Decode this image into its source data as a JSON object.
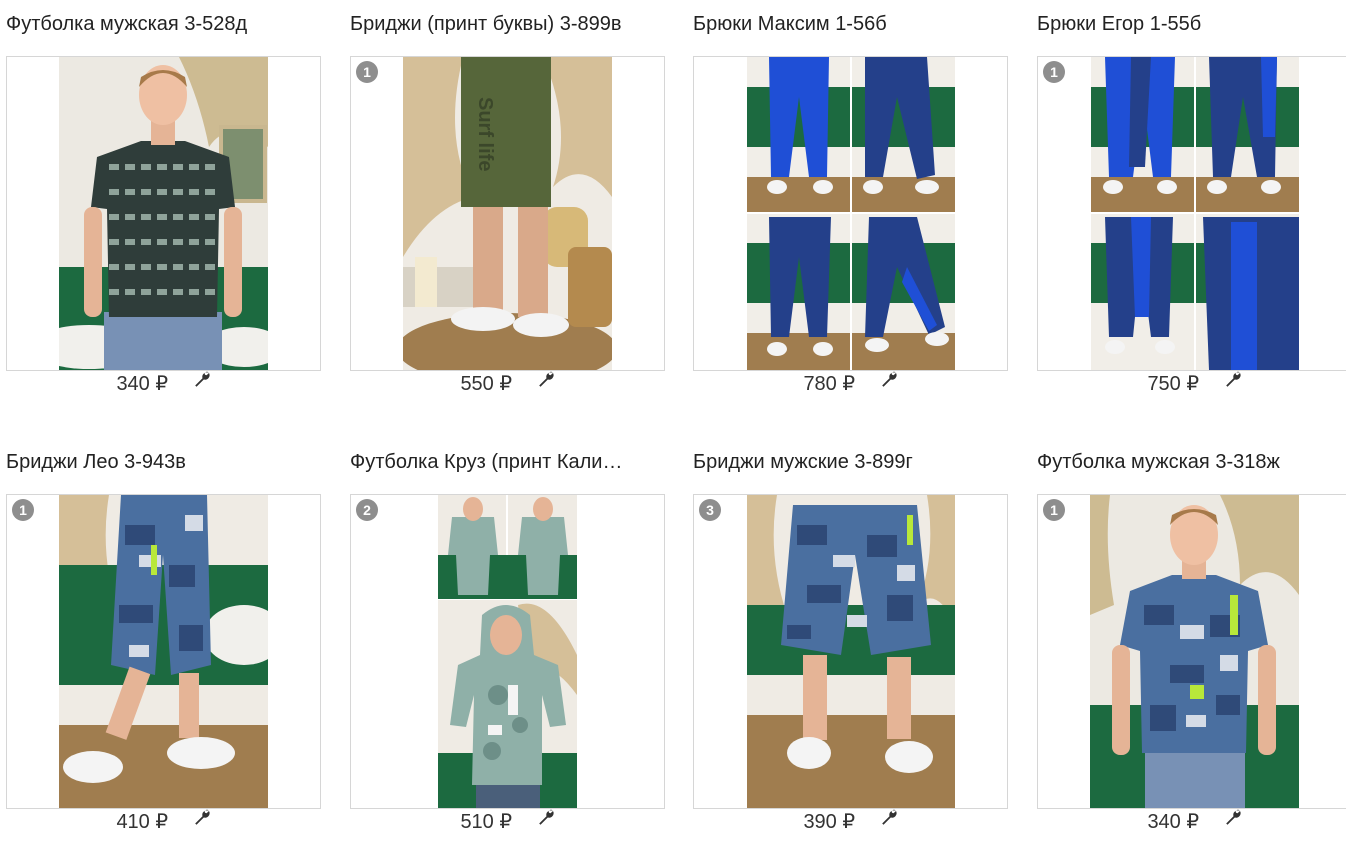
{
  "products": [
    {
      "title": "Футболка мужская 3-528д",
      "price": "340 ₽",
      "badge": "",
      "edit_icon": "wrench-icon"
    },
    {
      "title": "Бриджи (принт буквы) 3-899в",
      "price": "550 ₽",
      "badge": "1",
      "edit_icon": "wrench-icon",
      "photo_text": "Surf life"
    },
    {
      "title": "Брюки Максим 1-56б",
      "price": "780 ₽",
      "badge": "",
      "edit_icon": "wrench-icon"
    },
    {
      "title": "Брюки Егор 1-55б",
      "price": "750 ₽",
      "badge": "1",
      "edit_icon": "wrench-icon"
    },
    {
      "title": "Бриджи Лео 3-943в",
      "price": "410 ₽",
      "badge": "1",
      "edit_icon": "wrench-icon"
    },
    {
      "title": "Футболка Круз (принт Кали…",
      "price": "510 ₽",
      "badge": "2",
      "edit_icon": "wrench-icon"
    },
    {
      "title": "Бриджи мужские 3-899г",
      "price": "390 ₽",
      "badge": "3",
      "edit_icon": "wrench-icon"
    },
    {
      "title": "Футболка мужская 3-318ж",
      "price": "340 ₽",
      "badge": "1",
      "edit_icon": "wrench-icon"
    }
  ],
  "colors": {
    "badge_bg": "#8e8e8e",
    "card_border": "#d6d6d6",
    "camo_dark": "#3a4a45",
    "royal_blue": "#1f4fd6",
    "navy": "#24408a",
    "khaki": "#56663a",
    "blue_camo": "#4a6fa0",
    "sage": "#8fb0a8",
    "jute": "#a07d4f",
    "sofa_green": "#1c6a40"
  }
}
